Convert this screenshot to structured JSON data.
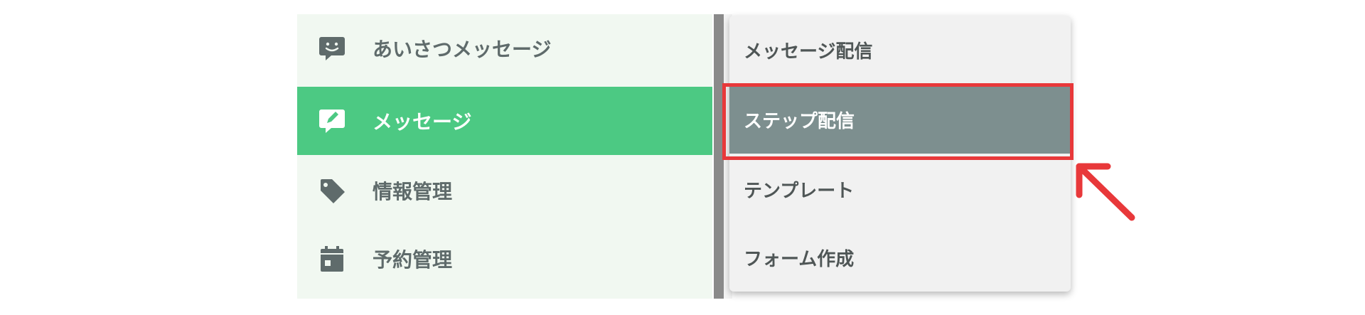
{
  "sidebar": {
    "items": [
      {
        "label": "あいさつメッセージ",
        "icon": "chat-smile-icon"
      },
      {
        "label": "メッセージ",
        "icon": "chat-edit-icon",
        "active": true
      },
      {
        "label": "情報管理",
        "icon": "tag-icon"
      },
      {
        "label": "予約管理",
        "icon": "calendar-icon"
      }
    ]
  },
  "submenu": {
    "items": [
      {
        "label": "メッセージ配信"
      },
      {
        "label": "ステップ配信",
        "selected": true
      },
      {
        "label": "テンプレート"
      },
      {
        "label": "フォーム作成"
      }
    ]
  },
  "colors": {
    "sidebar_bg": "#f1f8f1",
    "active_green": "#4cc983",
    "icon_gray": "#5f6b6b",
    "selected_bg": "#7d8f8f",
    "highlight_red": "#e8383a"
  }
}
